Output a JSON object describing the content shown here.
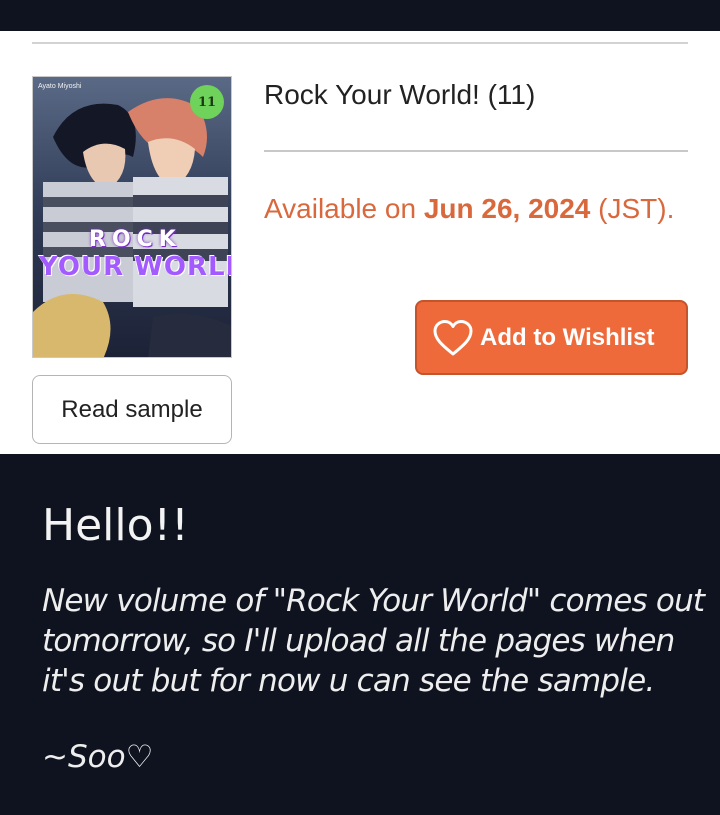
{
  "product": {
    "title": "Rock Your World! (11)",
    "availability_prefix": "Available on",
    "availability_date": "Jun 26, 2024",
    "availability_suffix": "(JST).",
    "wishlist_label": "Add to Wishlist",
    "sample_label": "Read sample",
    "cover": {
      "author": "Ayato Miyoshi",
      "volume": "11",
      "title_line1": "ROCK",
      "title_line2": "YOUR WORLD!"
    }
  },
  "post": {
    "greeting": "Hello!!",
    "message": "New volume of \"Rock Your World\" comes out tomorrow, so I'll upload all the pages when it's out but for now u can see the sample.",
    "signature": "~Soo♡"
  },
  "colors": {
    "accent": "#ee6a3a",
    "availability_text": "#d9683d",
    "dark_background": "#0e131f"
  },
  "icons": {
    "wishlist": "heart-outline-icon"
  }
}
